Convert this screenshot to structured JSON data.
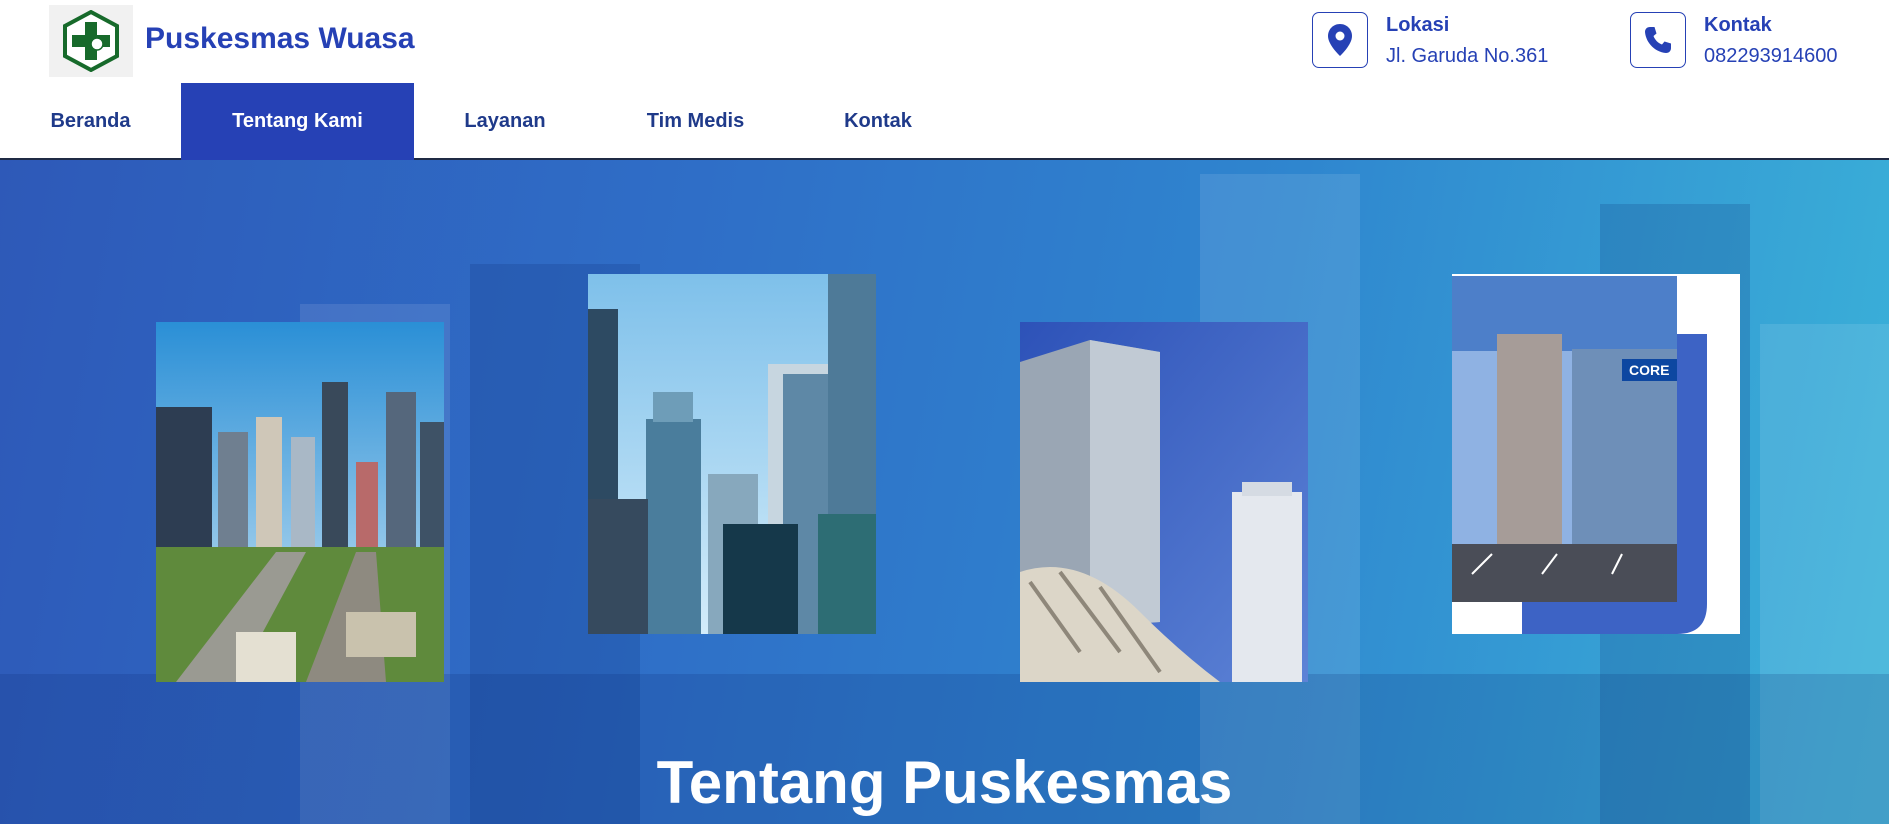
{
  "header": {
    "brand": "Puskesmas Wuasa",
    "logo_icon": "puskesmas-cross-logo",
    "location": {
      "title": "Lokasi",
      "value": "Jl. Garuda No.361",
      "icon": "map-pin-icon"
    },
    "contact": {
      "title": "Kontak",
      "value": "082293914600",
      "icon": "phone-icon"
    }
  },
  "nav": {
    "items": [
      {
        "label": "Beranda"
      },
      {
        "label": "Tentang Kami"
      },
      {
        "label": "Layanan"
      },
      {
        "label": "Tim Medis"
      },
      {
        "label": "Kontak"
      }
    ],
    "active": "Tentang Kami"
  },
  "hero": {
    "title": "Tentang Puskesmas",
    "photos": [
      {
        "name": "city-street-photo"
      },
      {
        "name": "skyscrapers-photo"
      },
      {
        "name": "tower-bridge-photo"
      },
      {
        "name": "office-building-photo",
        "sign_text": "CORE"
      }
    ]
  },
  "colors": {
    "primary": "#2641b5",
    "nav_text": "#1f3a8a",
    "hero_start": "#2e59b8",
    "hero_end": "#3bb3d9"
  }
}
